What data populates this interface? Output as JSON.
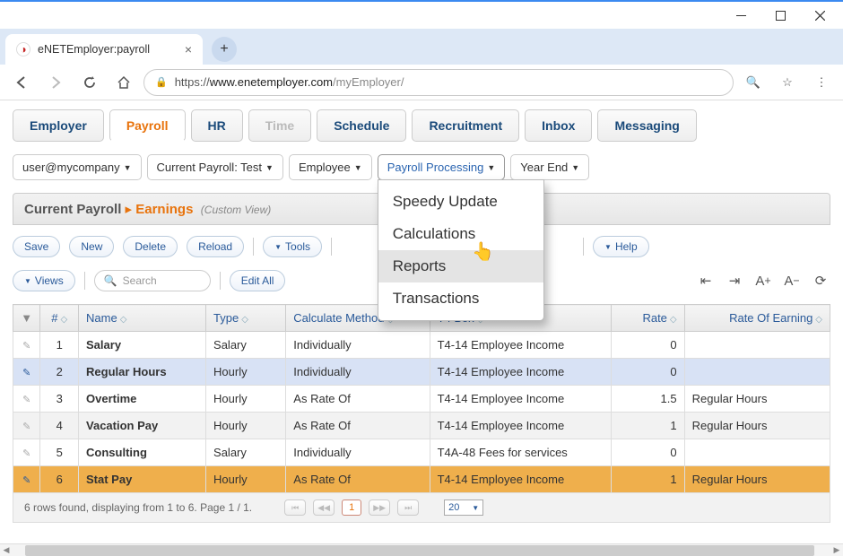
{
  "browser": {
    "tab_title": "eNETEmployer:payroll",
    "url_scheme": "https://",
    "url_host": "www.enetemployer.com",
    "url_path": "/myEmployer/"
  },
  "main_tabs": [
    {
      "label": "Employer",
      "state": ""
    },
    {
      "label": "Payroll",
      "state": "active"
    },
    {
      "label": "HR",
      "state": ""
    },
    {
      "label": "Time",
      "state": "disabled"
    },
    {
      "label": "Schedule",
      "state": ""
    },
    {
      "label": "Recruitment",
      "state": ""
    },
    {
      "label": "Inbox",
      "state": ""
    },
    {
      "label": "Messaging",
      "state": ""
    }
  ],
  "filters": {
    "user": "user@mycompany",
    "payroll": "Current Payroll: Test",
    "employee": "Employee",
    "processing": "Payroll Processing",
    "yearend": "Year End"
  },
  "dropdown": {
    "items": [
      "Speedy Update",
      "Calculations",
      "Reports",
      "Transactions"
    ],
    "hover_index": 2
  },
  "breadcrumb": {
    "lvl1": "Current Payroll",
    "lvl2": "Earnings",
    "note": "(Custom View)"
  },
  "actions": {
    "save": "Save",
    "new": "New",
    "delete": "Delete",
    "reload": "Reload",
    "tools": "Tools",
    "help": "Help",
    "views": "Views",
    "edit_all": "Edit All",
    "search_placeholder": "Search"
  },
  "columns": [
    "",
    "#",
    "Name",
    "Type",
    "Calculate Method",
    "T4 Box",
    "Rate",
    "Rate Of Earning"
  ],
  "rows": [
    {
      "num": "1",
      "name": "Salary",
      "type": "Salary",
      "calc": "Individually",
      "t4": "T4-14 Employee Income",
      "rate": "0",
      "roe": "",
      "cls": ""
    },
    {
      "num": "2",
      "name": "Regular Hours",
      "type": "Hourly",
      "calc": "Individually",
      "t4": "T4-14 Employee Income",
      "rate": "0",
      "roe": "",
      "cls": "selblue"
    },
    {
      "num": "3",
      "name": "Overtime",
      "type": "Hourly",
      "calc": "As Rate Of",
      "t4": "T4-14 Employee Income",
      "rate": "1.5",
      "roe": "Regular Hours",
      "cls": ""
    },
    {
      "num": "4",
      "name": "Vacation Pay",
      "type": "Hourly",
      "calc": "As Rate Of",
      "t4": "T4-14 Employee Income",
      "rate": "1",
      "roe": "Regular Hours",
      "cls": "alt"
    },
    {
      "num": "5",
      "name": "Consulting",
      "type": "Salary",
      "calc": "Individually",
      "t4": "T4A-48 Fees for services",
      "rate": "0",
      "roe": "",
      "cls": ""
    },
    {
      "num": "6",
      "name": "Stat Pay",
      "type": "Hourly",
      "calc": "As Rate Of",
      "t4": "T4-14 Employee Income",
      "rate": "1",
      "roe": "Regular Hours",
      "cls": "selorange"
    }
  ],
  "pager": {
    "summary": "6 rows found, displaying from 1 to 6. Page 1 / 1.",
    "page": "1",
    "page_size": "20"
  }
}
